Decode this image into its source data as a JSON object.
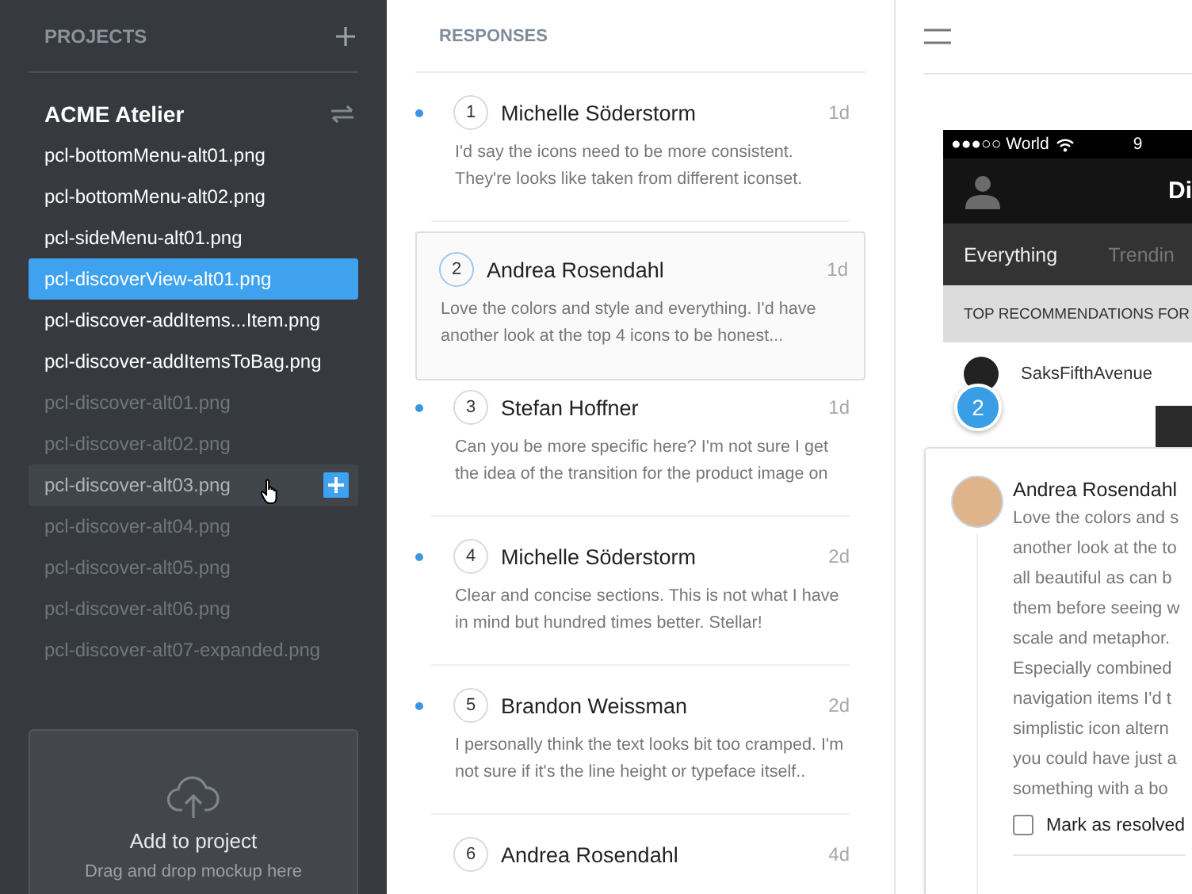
{
  "sidebar": {
    "heading": "PROJECTS",
    "project": {
      "name": "ACME Atelier"
    },
    "files": [
      {
        "name": "pcl-bottomMenu-alt01.png",
        "selected": false,
        "dimmed": false,
        "hovered": false
      },
      {
        "name": "pcl-bottomMenu-alt02.png",
        "selected": false,
        "dimmed": false,
        "hovered": false
      },
      {
        "name": "pcl-sideMenu-alt01.png",
        "selected": false,
        "dimmed": false,
        "hovered": false
      },
      {
        "name": "pcl-discoverView-alt01.png",
        "selected": true,
        "dimmed": false,
        "hovered": false
      },
      {
        "name": "pcl-discover-addItems...Item.png",
        "selected": false,
        "dimmed": false,
        "hovered": false
      },
      {
        "name": "pcl-discover-addItemsToBag.png",
        "selected": false,
        "dimmed": false,
        "hovered": false
      },
      {
        "name": "pcl-discover-alt01.png",
        "selected": false,
        "dimmed": true,
        "hovered": false
      },
      {
        "name": "pcl-discover-alt02.png",
        "selected": false,
        "dimmed": true,
        "hovered": false
      },
      {
        "name": "pcl-discover-alt03.png",
        "selected": false,
        "dimmed": true,
        "hovered": true
      },
      {
        "name": "pcl-discover-alt04.png",
        "selected": false,
        "dimmed": true,
        "hovered": false
      },
      {
        "name": "pcl-discover-alt05.png",
        "selected": false,
        "dimmed": true,
        "hovered": false
      },
      {
        "name": "pcl-discover-alt06.png",
        "selected": false,
        "dimmed": true,
        "hovered": false
      },
      {
        "name": "pcl-discover-alt07-expanded.png",
        "selected": false,
        "dimmed": true,
        "hovered": false
      }
    ],
    "upload": {
      "title": "Add to project",
      "hint": "Drag and drop mockup here"
    }
  },
  "responses": {
    "heading": "RESPONSES",
    "items": [
      {
        "number": "1",
        "name": "Michelle Söderstorm",
        "age": "1d",
        "unread": true,
        "selected": false,
        "text": "I'd say the icons need to be more consistent. They're looks like taken from different iconset."
      },
      {
        "number": "2",
        "name": "Andrea Rosendahl",
        "age": "1d",
        "unread": false,
        "selected": true,
        "text": "Love the colors and style and everything. I'd have another look at the top 4 icons to be honest..."
      },
      {
        "number": "3",
        "name": "Stefan Hoffner",
        "age": "1d",
        "unread": true,
        "selected": false,
        "text": "Can you be more specific here? I'm not sure I get the idea of the transition for the product image on"
      },
      {
        "number": "4",
        "name": "Michelle Söderstorm",
        "age": "2d",
        "unread": true,
        "selected": false,
        "text": "Clear and concise sections. This is not what I have in mind but hundred times better. Stellar!"
      },
      {
        "number": "5",
        "name": "Brandon Weissman",
        "age": "2d",
        "unread": true,
        "selected": false,
        "text": "I personally think the text looks bit too cramped. I'm not sure if it's the line height or typeface itself.."
      },
      {
        "number": "6",
        "name": "Andrea Rosendahl",
        "age": "4d",
        "unread": false,
        "selected": false
      }
    ]
  },
  "preview": {
    "phone": {
      "carrier": "●●●○○ World",
      "time": "9",
      "title": "Di",
      "tabs": [
        "Everything",
        "Trendin"
      ],
      "section": "TOP RECOMMENDATIONS FOR",
      "store": "SaksFifthAvenue"
    },
    "marker": "2",
    "comment": {
      "name": "Andrea Rosendahl",
      "lines": [
        "Love the colors and s",
        "another look at the to",
        "all beautiful as can b",
        "them before seeing w",
        "scale and metaphor.",
        "Especially combined",
        "navigation items I'd t",
        "simplistic icon altern",
        "you could have just a",
        "something with a bo"
      ],
      "resolved": {
        "label": "Mark as resolved",
        "checked": false
      }
    }
  }
}
